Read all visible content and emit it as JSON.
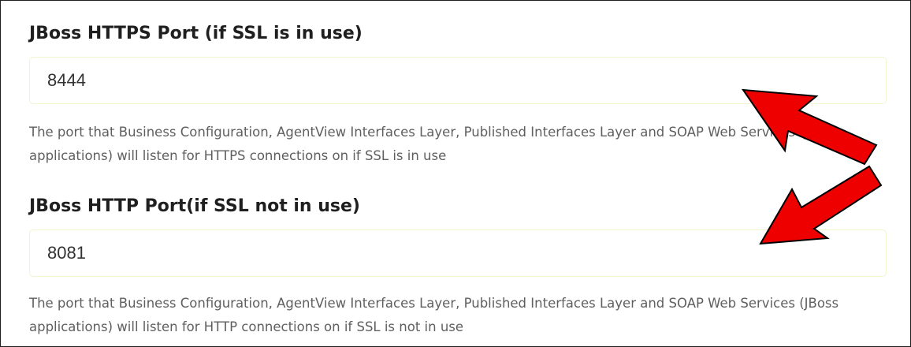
{
  "fields": [
    {
      "label": "JBoss HTTPS Port (if SSL is in use)",
      "value": "8444",
      "help": "The port that Business Configuration, AgentView Interfaces Layer, Published Interfaces Layer and SOAP Web Services (JBoss applications) will listen for HTTPS connections on if SSL is in use"
    },
    {
      "label": "JBoss HTTP Port(if SSL not in use)",
      "value": "8081",
      "help": "The port that Business Configuration, AgentView Interfaces Layer, Published Interfaces Layer and SOAP Web Services (JBoss applications) will listen for HTTP connections on if SSL is not in use"
    }
  ],
  "annotations": {
    "arrow_color": "#ee0000",
    "arrow_outline": "#000000",
    "arrows": [
      "arrow-pointing-up-left",
      "arrow-pointing-down-left"
    ]
  }
}
